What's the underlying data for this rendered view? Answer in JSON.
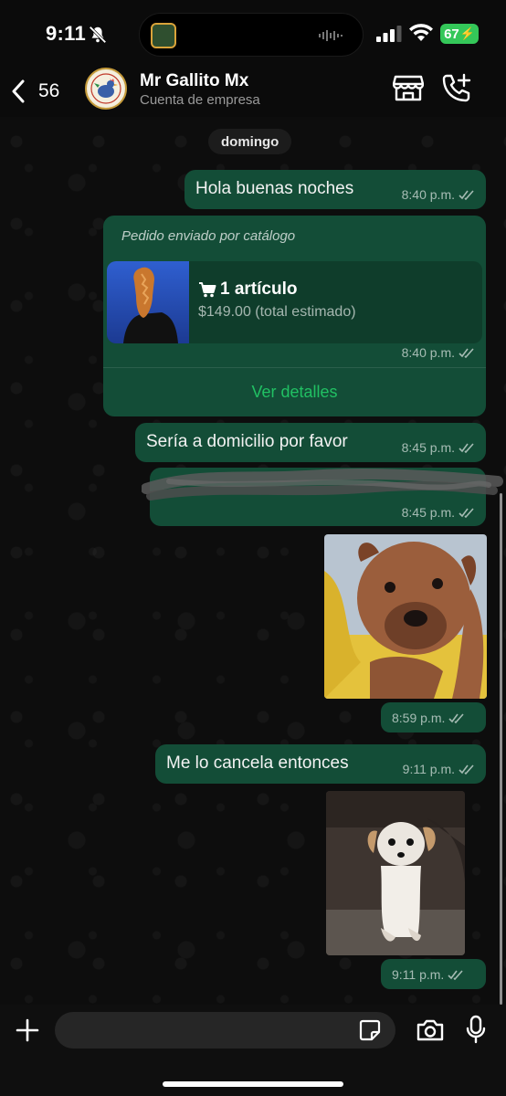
{
  "status_bar": {
    "time": "9:11",
    "battery": "67"
  },
  "header": {
    "back_count": "56",
    "avatar_text": "MR GALLITO",
    "contact_name": "Mr Gallito Mx",
    "contact_subtitle": "Cuenta de empresa"
  },
  "chat": {
    "day_label": "domingo",
    "messages": [
      {
        "type": "text",
        "text": "Hola buenas noches",
        "time": "8:40 p.m."
      },
      {
        "type": "order",
        "caption": "Pedido enviado por catálogo",
        "items": "1 artículo",
        "total": "$149.00 (total estimado)",
        "time": "8:40 p.m.",
        "action": "Ver detalles"
      },
      {
        "type": "text",
        "text": "Sería a domicilio por favor",
        "time": "8:45 p.m."
      },
      {
        "type": "redacted",
        "time": "8:45 p.m."
      },
      {
        "type": "image",
        "time": "8:59 p.m."
      },
      {
        "type": "text",
        "text": "Me lo cancela entonces",
        "time": "9:11 p.m."
      },
      {
        "type": "image",
        "time": "9:11 p.m."
      }
    ]
  },
  "input": {
    "placeholder": ""
  },
  "colors": {
    "bubble": "#134d37",
    "link": "#21c063",
    "battery": "#34c759"
  }
}
